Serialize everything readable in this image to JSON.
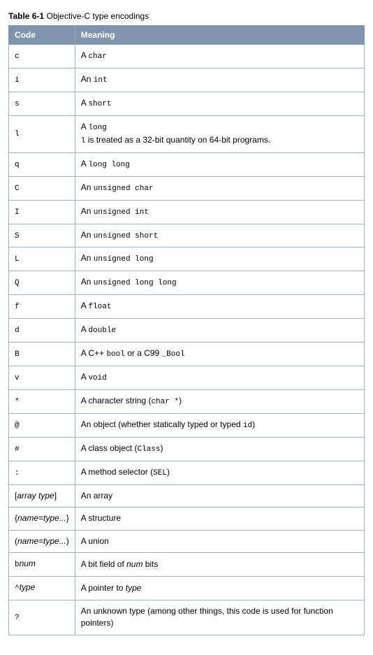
{
  "caption": {
    "label": "Table 6-1",
    "title": "Objective-C type encodings"
  },
  "headers": {
    "code": "Code",
    "meaning": "Meaning"
  },
  "rows": [
    {
      "code": [
        {
          "t": "mono",
          "v": "c"
        }
      ],
      "meaning": [
        {
          "t": "plain",
          "v": "A "
        },
        {
          "t": "mono",
          "v": "char"
        }
      ]
    },
    {
      "code": [
        {
          "t": "mono",
          "v": "i"
        }
      ],
      "meaning": [
        {
          "t": "plain",
          "v": "An "
        },
        {
          "t": "mono",
          "v": "int"
        }
      ]
    },
    {
      "code": [
        {
          "t": "mono",
          "v": "s"
        }
      ],
      "meaning": [
        {
          "t": "plain",
          "v": "A "
        },
        {
          "t": "mono",
          "v": "short"
        }
      ]
    },
    {
      "code": [
        {
          "t": "mono",
          "v": "l"
        }
      ],
      "meaning": [
        {
          "t": "plain",
          "v": "A "
        },
        {
          "t": "mono",
          "v": "long"
        },
        {
          "t": "br"
        },
        {
          "t": "mono",
          "v": "l"
        },
        {
          "t": "plain",
          "v": " is treated as a 32-bit quantity on 64-bit programs."
        }
      ]
    },
    {
      "code": [
        {
          "t": "mono",
          "v": "q"
        }
      ],
      "meaning": [
        {
          "t": "plain",
          "v": "A "
        },
        {
          "t": "mono",
          "v": "long long"
        }
      ]
    },
    {
      "code": [
        {
          "t": "mono",
          "v": "C"
        }
      ],
      "meaning": [
        {
          "t": "plain",
          "v": "An "
        },
        {
          "t": "mono",
          "v": "unsigned char"
        }
      ]
    },
    {
      "code": [
        {
          "t": "mono",
          "v": "I"
        }
      ],
      "meaning": [
        {
          "t": "plain",
          "v": "An "
        },
        {
          "t": "mono",
          "v": "unsigned int"
        }
      ]
    },
    {
      "code": [
        {
          "t": "mono",
          "v": "S"
        }
      ],
      "meaning": [
        {
          "t": "plain",
          "v": "An "
        },
        {
          "t": "mono",
          "v": "unsigned short"
        }
      ]
    },
    {
      "code": [
        {
          "t": "mono",
          "v": "L"
        }
      ],
      "meaning": [
        {
          "t": "plain",
          "v": "An "
        },
        {
          "t": "mono",
          "v": "unsigned long"
        }
      ]
    },
    {
      "code": [
        {
          "t": "mono",
          "v": "Q"
        }
      ],
      "meaning": [
        {
          "t": "plain",
          "v": "An "
        },
        {
          "t": "mono",
          "v": "unsigned long long"
        }
      ]
    },
    {
      "code": [
        {
          "t": "mono",
          "v": "f"
        }
      ],
      "meaning": [
        {
          "t": "plain",
          "v": "A "
        },
        {
          "t": "mono",
          "v": "float"
        }
      ]
    },
    {
      "code": [
        {
          "t": "mono",
          "v": "d"
        }
      ],
      "meaning": [
        {
          "t": "plain",
          "v": "A "
        },
        {
          "t": "mono",
          "v": "double"
        }
      ]
    },
    {
      "code": [
        {
          "t": "mono",
          "v": "B"
        }
      ],
      "meaning": [
        {
          "t": "plain",
          "v": "A C++ "
        },
        {
          "t": "mono",
          "v": "bool"
        },
        {
          "t": "plain",
          "v": " or a C99 "
        },
        {
          "t": "mono",
          "v": "_Bool"
        }
      ]
    },
    {
      "code": [
        {
          "t": "mono",
          "v": "v"
        }
      ],
      "meaning": [
        {
          "t": "plain",
          "v": "A "
        },
        {
          "t": "mono",
          "v": "void"
        }
      ]
    },
    {
      "code": [
        {
          "t": "mono",
          "v": "*"
        }
      ],
      "meaning": [
        {
          "t": "plain",
          "v": "A character string ("
        },
        {
          "t": "mono",
          "v": "char *"
        },
        {
          "t": "plain",
          "v": ")"
        }
      ]
    },
    {
      "code": [
        {
          "t": "mono",
          "v": "@"
        }
      ],
      "meaning": [
        {
          "t": "plain",
          "v": "An object (whether statically typed or typed "
        },
        {
          "t": "mono",
          "v": "id"
        },
        {
          "t": "plain",
          "v": ")"
        }
      ]
    },
    {
      "code": [
        {
          "t": "mono",
          "v": "#"
        }
      ],
      "meaning": [
        {
          "t": "plain",
          "v": "A class object ("
        },
        {
          "t": "mono",
          "v": "Class"
        },
        {
          "t": "plain",
          "v": ")"
        }
      ]
    },
    {
      "code": [
        {
          "t": "mono",
          "v": ":"
        }
      ],
      "meaning": [
        {
          "t": "plain",
          "v": "A method selector ("
        },
        {
          "t": "mono",
          "v": "SEL"
        },
        {
          "t": "plain",
          "v": ")"
        }
      ]
    },
    {
      "code": [
        {
          "t": "plain",
          "v": "["
        },
        {
          "t": "ital",
          "v": "array type"
        },
        {
          "t": "plain",
          "v": "]"
        }
      ],
      "meaning": [
        {
          "t": "plain",
          "v": "An array"
        }
      ]
    },
    {
      "code": [
        {
          "t": "plain",
          "v": "{"
        },
        {
          "t": "ital",
          "v": "name=type..."
        },
        {
          "t": "plain",
          "v": "}"
        }
      ],
      "meaning": [
        {
          "t": "plain",
          "v": "A structure"
        }
      ]
    },
    {
      "code": [
        {
          "t": "plain",
          "v": "("
        },
        {
          "t": "ital",
          "v": "name=type..."
        },
        {
          "t": "plain",
          "v": ")"
        }
      ],
      "meaning": [
        {
          "t": "plain",
          "v": "A union"
        }
      ]
    },
    {
      "code": [
        {
          "t": "mono",
          "v": "b"
        },
        {
          "t": "ital",
          "v": "num"
        }
      ],
      "meaning": [
        {
          "t": "plain",
          "v": "A bit field of "
        },
        {
          "t": "ital",
          "v": "num"
        },
        {
          "t": "plain",
          "v": " bits"
        }
      ]
    },
    {
      "code": [
        {
          "t": "mono",
          "v": "^"
        },
        {
          "t": "ital",
          "v": "type"
        }
      ],
      "meaning": [
        {
          "t": "plain",
          "v": "A pointer to "
        },
        {
          "t": "ital",
          "v": "type"
        }
      ]
    },
    {
      "code": [
        {
          "t": "mono",
          "v": "?"
        }
      ],
      "meaning": [
        {
          "t": "plain",
          "v": "An unknown type (among other things, this code is used for function pointers)"
        }
      ]
    }
  ]
}
